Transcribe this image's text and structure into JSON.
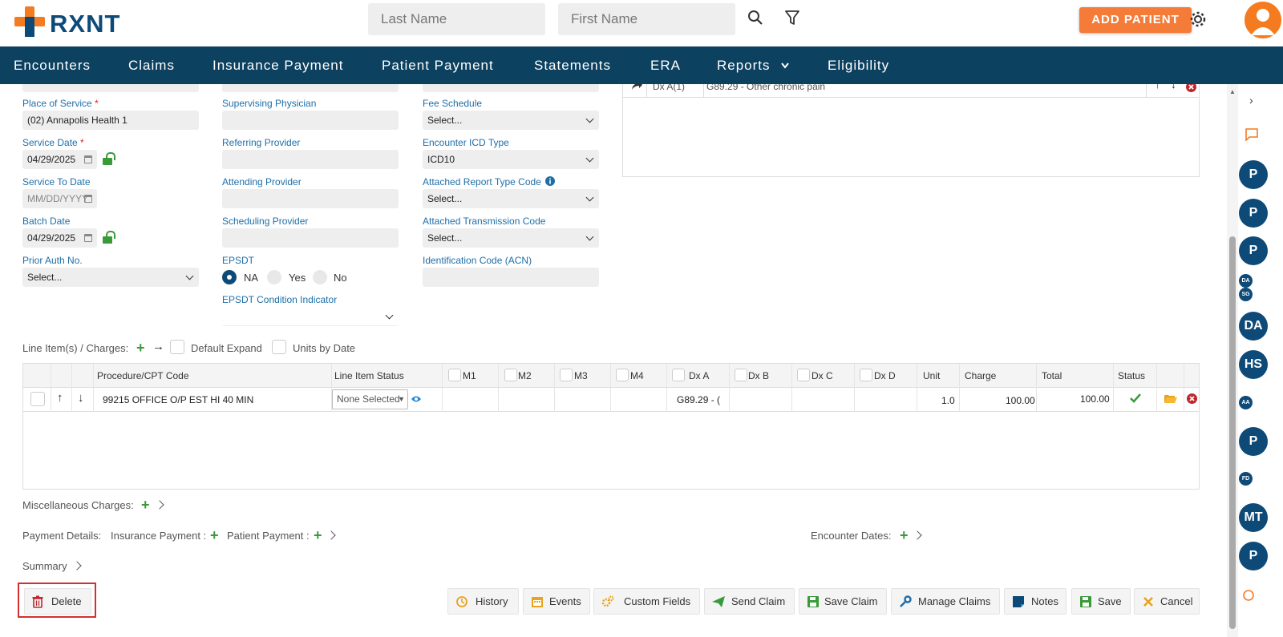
{
  "header": {
    "logo_text": "RXNT",
    "last_name_placeholder": "Last Name",
    "first_name_placeholder": "First Name",
    "add_patient_label": "ADD PATIENT"
  },
  "nav": {
    "items": [
      "Encounters",
      "Claims",
      "Insurance Payment",
      "Patient Payment",
      "Statements",
      "ERA",
      "Reports",
      "Eligibility"
    ]
  },
  "form": {
    "place_of_service_label": "Place of Service",
    "place_of_service_value": "(02) Annapolis Health 1",
    "service_date_label": "Service Date",
    "service_date_value": "04/29/2025",
    "service_to_date_label": "Service To Date",
    "service_to_date_placeholder": "MM/DD/YYYY",
    "batch_date_label": "Batch Date",
    "batch_date_value": "04/29/2025",
    "prior_auth_label": "Prior Auth No.",
    "prior_auth_value": "Select...",
    "supervising_label": "Supervising Physician",
    "referring_label": "Referring Provider",
    "attending_label": "Attending Provider",
    "scheduling_label": "Scheduling Provider",
    "epsdt_label": "EPSDT",
    "epsdt_options": [
      "NA",
      "Yes",
      "No"
    ],
    "epsdt_condition_label": "EPSDT Condition Indicator",
    "fee_schedule_label": "Fee Schedule",
    "fee_schedule_value": "Select...",
    "icd_type_label": "Encounter ICD Type",
    "icd_type_value": "ICD10",
    "report_type_label": "Attached Report Type Code",
    "report_type_value": "Select...",
    "transmission_label": "Attached Transmission Code",
    "transmission_value": "Select...",
    "identification_label": "Identification Code (ACN)"
  },
  "dx_panel": {
    "code_label": "Dx A(1)",
    "code_desc": "G89.29 - Other chronic pain"
  },
  "line_items": {
    "label": "Line Item(s) / Charges:",
    "default_expand_label": "Default Expand",
    "units_by_date_label": "Units by Date",
    "headers": [
      "Procedure/CPT Code",
      "Line Item Status",
      "M1",
      "M2",
      "M3",
      "M4",
      "Dx A",
      "Dx B",
      "Dx C",
      "Dx D",
      "Unit",
      "Charge",
      "Total",
      "Status"
    ],
    "row": {
      "code": "99215 OFFICE O/P EST HI 40 MIN",
      "status": "None Selected",
      "dx_a": "G89.29 - (",
      "unit": "1.0",
      "charge": "100.00",
      "total": "100.00"
    }
  },
  "sections": {
    "misc_label": "Miscellaneous Charges:",
    "payment_details_label": "Payment Details:",
    "insurance_payment_label": "Insurance Payment :",
    "patient_payment_label": "Patient Payment :",
    "encounter_dates_label": "Encounter Dates:",
    "summary_label": "Summary"
  },
  "buttons": {
    "delete": "Delete",
    "history": "History",
    "events": "Events",
    "custom_fields": "Custom Fields",
    "send_claim": "Send Claim",
    "save_claim": "Save Claim",
    "manage_claims": "Manage Claims",
    "notes": "Notes",
    "save": "Save",
    "cancel": "Cancel"
  },
  "sidebar_initials": [
    "P",
    "P",
    "P",
    "DA",
    "SG",
    "DA",
    "HS",
    "AA",
    "P",
    "FD",
    "MT",
    "P"
  ],
  "colors": {
    "brand_orange": "#f47b20",
    "brand_navy": "#0d4160",
    "label_blue": "#1e6fa8",
    "success_green": "#3a9a3a",
    "highlight_red": "#d32f2f"
  }
}
